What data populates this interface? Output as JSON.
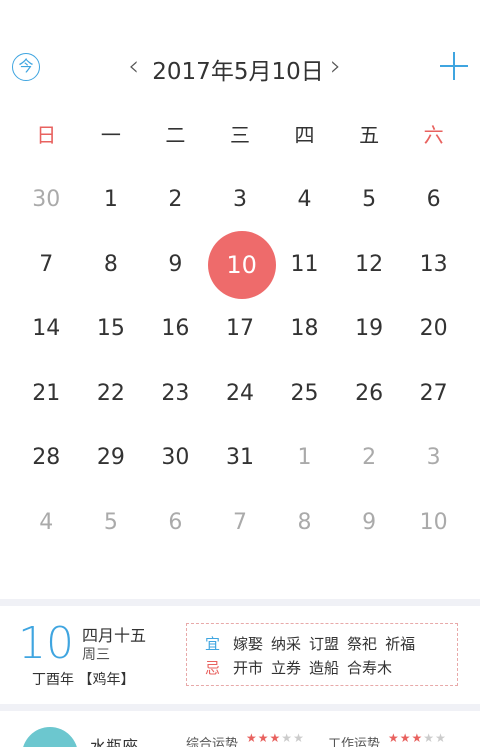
{
  "header": {
    "today_label": "今",
    "prev": "‹",
    "title": "2017年5月10日",
    "next": "›"
  },
  "weekdays": [
    "日",
    "一",
    "二",
    "三",
    "四",
    "五",
    "六"
  ],
  "weeks": [
    [
      "30",
      "1",
      "2",
      "3",
      "4",
      "5",
      "6"
    ],
    [
      "7",
      "8",
      "9",
      "10",
      "11",
      "12",
      "13"
    ],
    [
      "14",
      "15",
      "16",
      "17",
      "18",
      "19",
      "20"
    ],
    [
      "21",
      "22",
      "23",
      "24",
      "25",
      "26",
      "27"
    ],
    [
      "28",
      "29",
      "30",
      "31",
      "1",
      "2",
      "3"
    ],
    [
      "4",
      "5",
      "6",
      "7",
      "8",
      "9",
      "10"
    ]
  ],
  "info": {
    "day": "10",
    "lunar": "四月十五",
    "weekday": "周三",
    "ganzhi": "丁酉年 【鸡年】",
    "yi_label": "宜",
    "yi_items": [
      "嫁娶",
      "纳采",
      "订盟",
      "祭祀",
      "祈福"
    ],
    "ji_label": "忌",
    "ji_items": [
      "开市",
      "立券",
      "造船",
      "合寿木"
    ]
  },
  "horoscope": {
    "sign": "水瓶座",
    "overall_label": "综合运势",
    "overall_stars": 3,
    "work_label": "工作运势",
    "work_stars": 3,
    "max_stars": 5
  },
  "colors": {
    "accent": "#3fa5e0",
    "selected": "#ee6b6b",
    "weekend": "#e8625f"
  }
}
